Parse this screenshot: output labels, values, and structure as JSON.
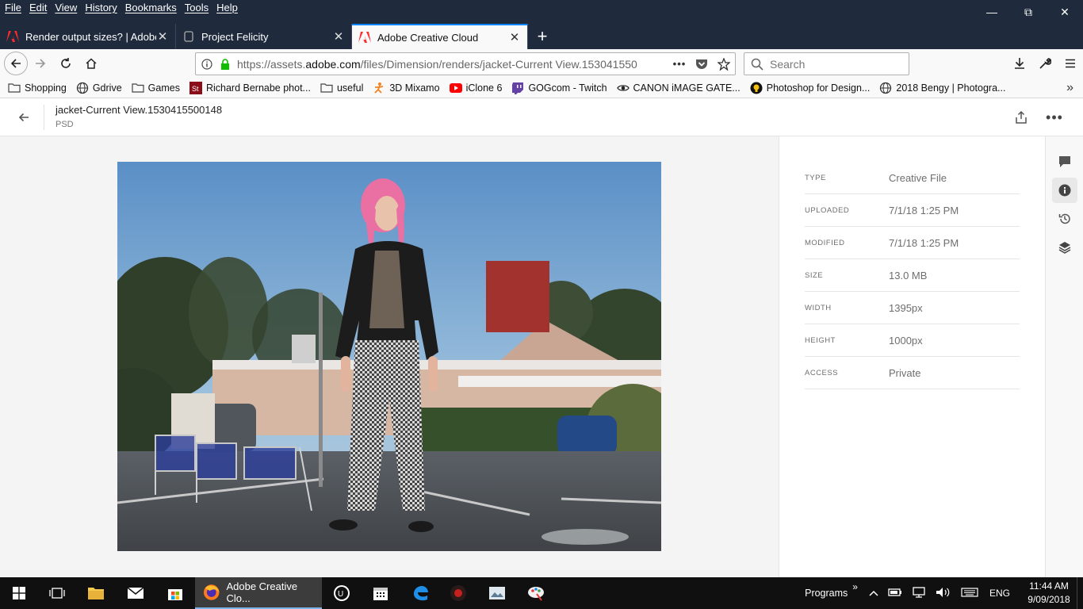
{
  "menu": [
    "File",
    "Edit",
    "View",
    "History",
    "Bookmarks",
    "Tools",
    "Help"
  ],
  "window_controls": [
    "minimize-icon",
    "restore-icon",
    "close-icon"
  ],
  "tabs": [
    {
      "title": "Render output sizes? | Adobe C",
      "icon": "adobe-icon",
      "active": false
    },
    {
      "title": "Project Felicity",
      "icon": "page-icon",
      "active": false
    },
    {
      "title": "Adobe Creative Cloud",
      "icon": "adobe-icon",
      "active": true
    }
  ],
  "url": {
    "prefix": "https://assets.",
    "domain": "adobe.com",
    "path": "/files/Dimension/renders/jacket-Current View.153041550"
  },
  "search": {
    "placeholder": "Search"
  },
  "bookmarks": [
    {
      "label": "Shopping",
      "icon": "folder-icon"
    },
    {
      "label": "Gdrive",
      "icon": "globe-icon"
    },
    {
      "label": "Games",
      "icon": "folder-icon"
    },
    {
      "label": "Richard Bernabe phot...",
      "icon": "st-icon"
    },
    {
      "label": "useful",
      "icon": "folder-icon"
    },
    {
      "label": "3D Mixamo",
      "icon": "mixamo-icon"
    },
    {
      "label": "iClone 6",
      "icon": "youtube-icon"
    },
    {
      "label": "GOGcom - Twitch",
      "icon": "twitch-icon"
    },
    {
      "label": "CANON iMAGE GATE...",
      "icon": "eye-icon"
    },
    {
      "label": "Photoshop for Design...",
      "icon": "bulb-icon"
    },
    {
      "label": "2018 Bengy | Photogra...",
      "icon": "globe-icon"
    }
  ],
  "file": {
    "name": "jacket-Current View.1530415500148",
    "type": "PSD"
  },
  "details": [
    {
      "key": "TYPE",
      "value": "Creative File"
    },
    {
      "key": "UPLOADED",
      "value": "7/1/18 1:25 PM"
    },
    {
      "key": "MODIFIED",
      "value": "7/1/18 1:25 PM"
    },
    {
      "key": "SIZE",
      "value": "13.0 MB"
    },
    {
      "key": "WIDTH",
      "value": "1395px"
    },
    {
      "key": "HEIGHT",
      "value": "1000px"
    },
    {
      "key": "ACCESS",
      "value": "Private"
    }
  ],
  "taskbar": {
    "active_app": "Adobe Creative Clo...",
    "programs": "Programs",
    "lang": "ENG",
    "time": "11:44 AM",
    "date": "9/09/2018"
  },
  "colors": {
    "accent": "#0a84ff",
    "titlebar": "#1f2a3d",
    "taskbar": "#101010"
  }
}
